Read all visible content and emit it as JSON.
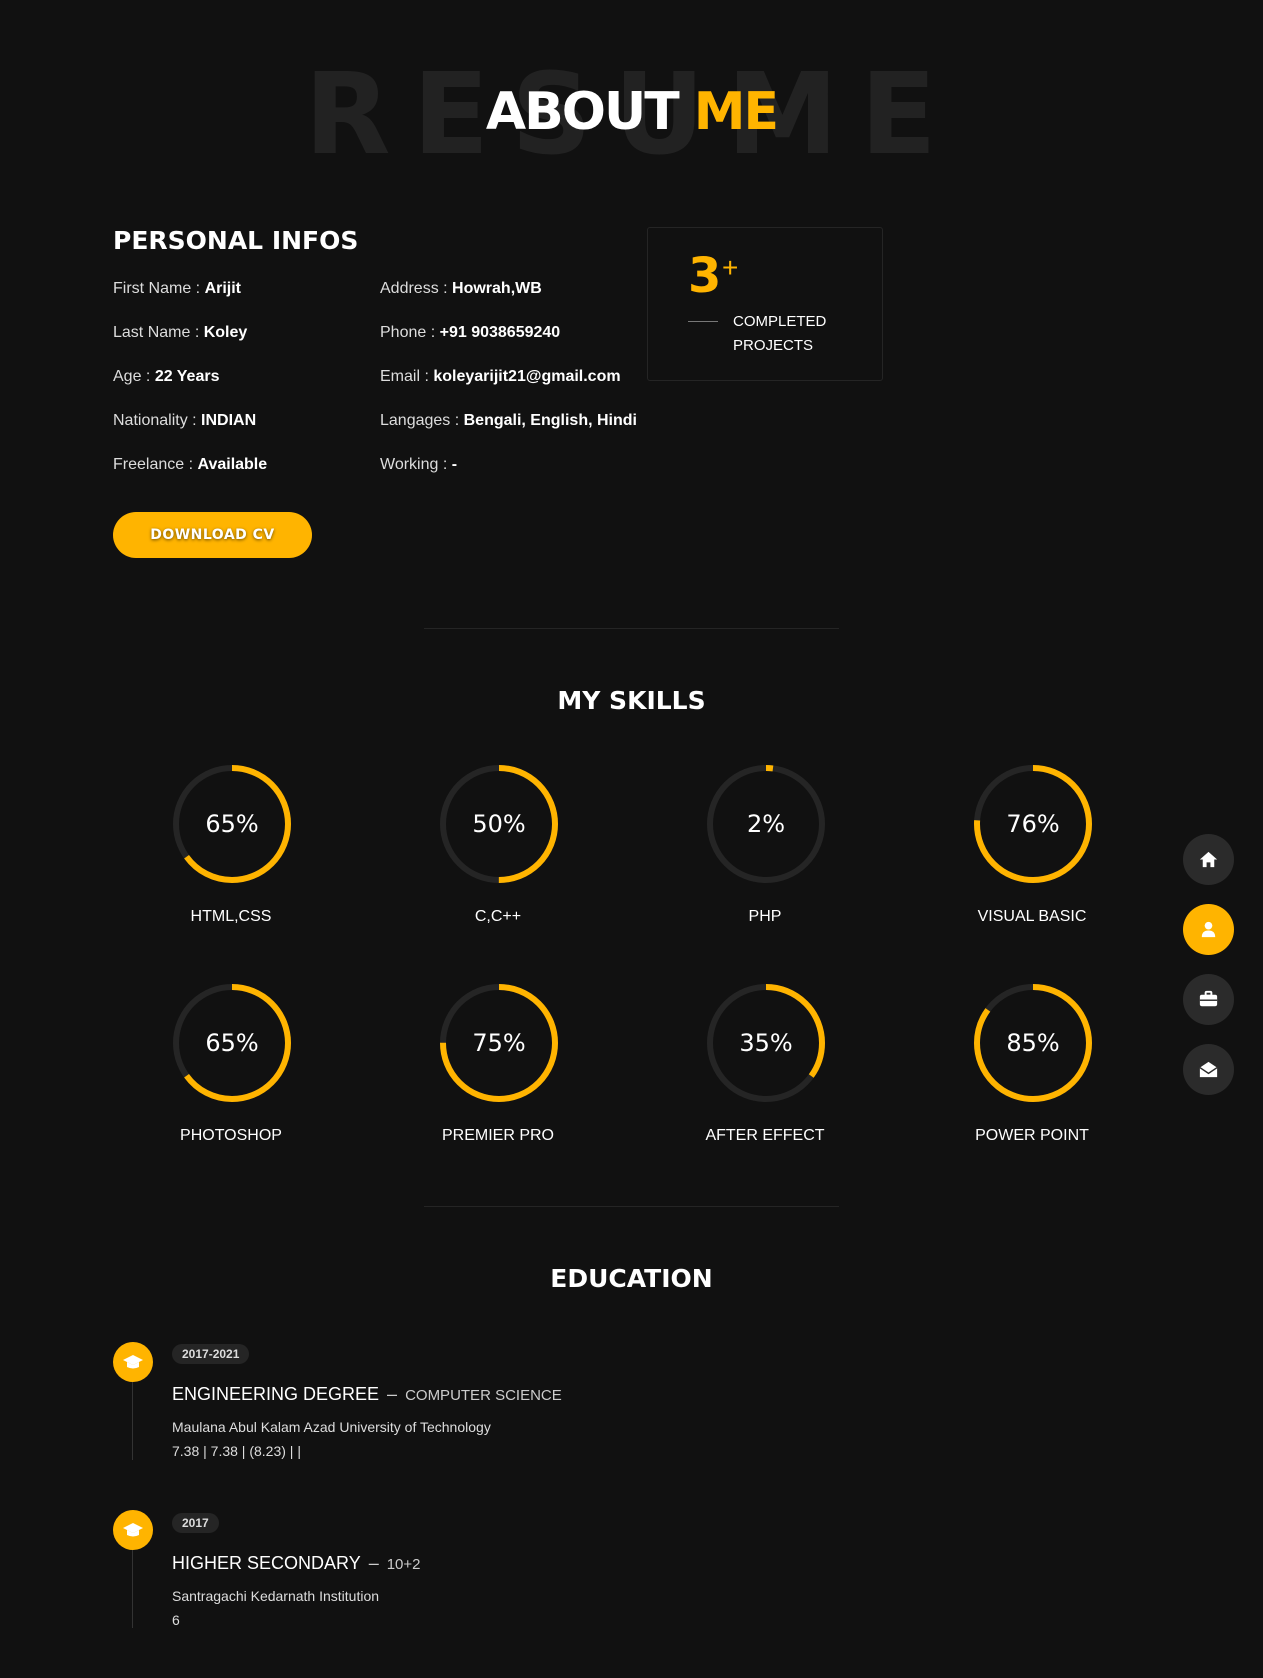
{
  "header": {
    "bg_text": "RESUME",
    "title_main": "ABOUT",
    "title_accent": "ME"
  },
  "personal": {
    "heading": "PERSONAL INFOS",
    "left": [
      {
        "label": "First Name : ",
        "value": "Arijit"
      },
      {
        "label": "Last Name : ",
        "value": "Koley"
      },
      {
        "label": "Age : ",
        "value": "22 Years"
      },
      {
        "label": "Nationality : ",
        "value": "INDIAN"
      },
      {
        "label": "Freelance : ",
        "value": "Available"
      }
    ],
    "right": [
      {
        "label": "Address : ",
        "value": "Howrah,WB"
      },
      {
        "label": "Phone : ",
        "value": "+91 9038659240"
      },
      {
        "label": "Email : ",
        "value": "koleyarijit21@gmail.com"
      },
      {
        "label": "Langages : ",
        "value": "Bengali, English, Hindi"
      },
      {
        "label": "Working : ",
        "value": "-"
      }
    ],
    "download_label": "DOWNLOAD CV"
  },
  "projects": {
    "count": "3",
    "plus": "+",
    "label_line1": "COMPLETED",
    "label_line2": "PROJECTS"
  },
  "skills": {
    "heading": "MY SKILLS",
    "items": [
      {
        "name": "HTML,CSS",
        "percent": 65,
        "label": "65%"
      },
      {
        "name": "C,C++",
        "percent": 50,
        "label": "50%"
      },
      {
        "name": "PHP",
        "percent": 2,
        "label": "2%"
      },
      {
        "name": "VISUAL BASIC",
        "percent": 76,
        "label": "76%"
      },
      {
        "name": "PHOTOSHOP",
        "percent": 65,
        "label": "65%"
      },
      {
        "name": "PREMIER PRO",
        "percent": 75,
        "label": "75%"
      },
      {
        "name": "AFTER EFFECT",
        "percent": 35,
        "label": "35%"
      },
      {
        "name": "POWER POINT",
        "percent": 85,
        "label": "85%"
      }
    ]
  },
  "education": {
    "heading": "EDUCATION",
    "items": [
      {
        "years": "2017-2021",
        "title": "ENGINEERING DEGREE",
        "field": "COMPUTER SCIENCE",
        "institution": "Maulana Abul Kalam Azad University of Technology",
        "scores": "7.38 | 7.38 | (8.23) | |"
      },
      {
        "years": "2017",
        "title": "HIGHER SECONDARY",
        "field": "10+2",
        "institution": "Santragachi Kedarnath Institution",
        "scores": "6"
      }
    ]
  },
  "nav": [
    {
      "icon": "home-icon",
      "active": false
    },
    {
      "icon": "user-icon",
      "active": true
    },
    {
      "icon": "briefcase-icon",
      "active": false
    },
    {
      "icon": "envelope-open-icon",
      "active": false
    }
  ],
  "colors": {
    "accent": "#ffb400",
    "background": "#111111",
    "track": "#252525"
  }
}
